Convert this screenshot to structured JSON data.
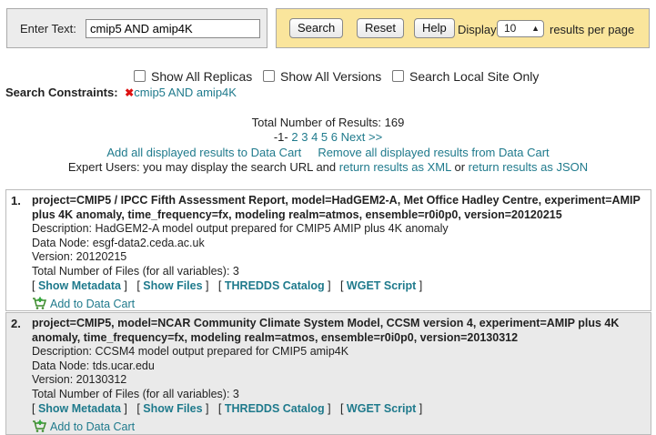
{
  "search": {
    "label": "Enter Text:",
    "value": "cmip5 AND amip4K"
  },
  "controls": {
    "search_label": "Search",
    "reset_label": "Reset",
    "help_label": "Help",
    "display_label": "Display",
    "per_page_value": "10",
    "per_page_suffix": "results per page"
  },
  "options": {
    "replicas": "Show All Replicas",
    "versions": "Show All Versions",
    "local": "Search Local Site Only"
  },
  "constraints": {
    "label": "Search Constraints:",
    "value": "cmip5 AND amip4K"
  },
  "summary": {
    "total": "Total Number of Results: 169",
    "current_page": "-1-",
    "pages": [
      "2",
      "3",
      "4",
      "5",
      "6"
    ],
    "next": "Next >>",
    "add_all": "Add all displayed results to Data Cart",
    "remove_all": "Remove all displayed results from Data Cart",
    "expert_prefix": "Expert Users: you may display the search URL and",
    "xml_link": "return results as XML",
    "or": "or",
    "json_link": "return results as JSON"
  },
  "results": [
    {
      "number": "1.",
      "title": "project=CMIP5 / IPCC Fifth Assessment Report, model=HadGEM2-A, Met Office Hadley Centre, experiment=AMIP plus 4K anomaly, time_frequency=fx, modeling realm=atmos, ensemble=r0i0p0, version=20120215",
      "description": "Description: HadGEM2-A model output prepared for CMIP5 AMIP plus 4K anomaly",
      "data_node": "Data Node: esgf-data2.ceda.ac.uk",
      "version": "Version: 20120215",
      "files": "Total Number of Files (for all variables): 3",
      "link_metadata": "Show Metadata",
      "link_files": "Show Files",
      "link_thredds": "THREDDS Catalog",
      "link_wget": "WGET Script",
      "add_cart": "Add to Data Cart"
    },
    {
      "number": "2.",
      "title": "project=CMIP5, model=NCAR Community Climate System Model, CCSM version 4, experiment=AMIP plus 4K anomaly, time_frequency=fx, modeling realm=atmos, ensemble=r0i0p0, version=20130312",
      "description": "Description: CCSM4 model output prepared for CMIP5 amip4K",
      "data_node": "Data Node: tds.ucar.edu",
      "version": "Version: 20130312",
      "files": "Total Number of Files (for all variables): 3",
      "link_metadata": "Show Metadata",
      "link_files": "Show Files",
      "link_thredds": "THREDDS Catalog",
      "link_wget": "WGET Script",
      "add_cart": "Add to Data Cart"
    }
  ]
}
